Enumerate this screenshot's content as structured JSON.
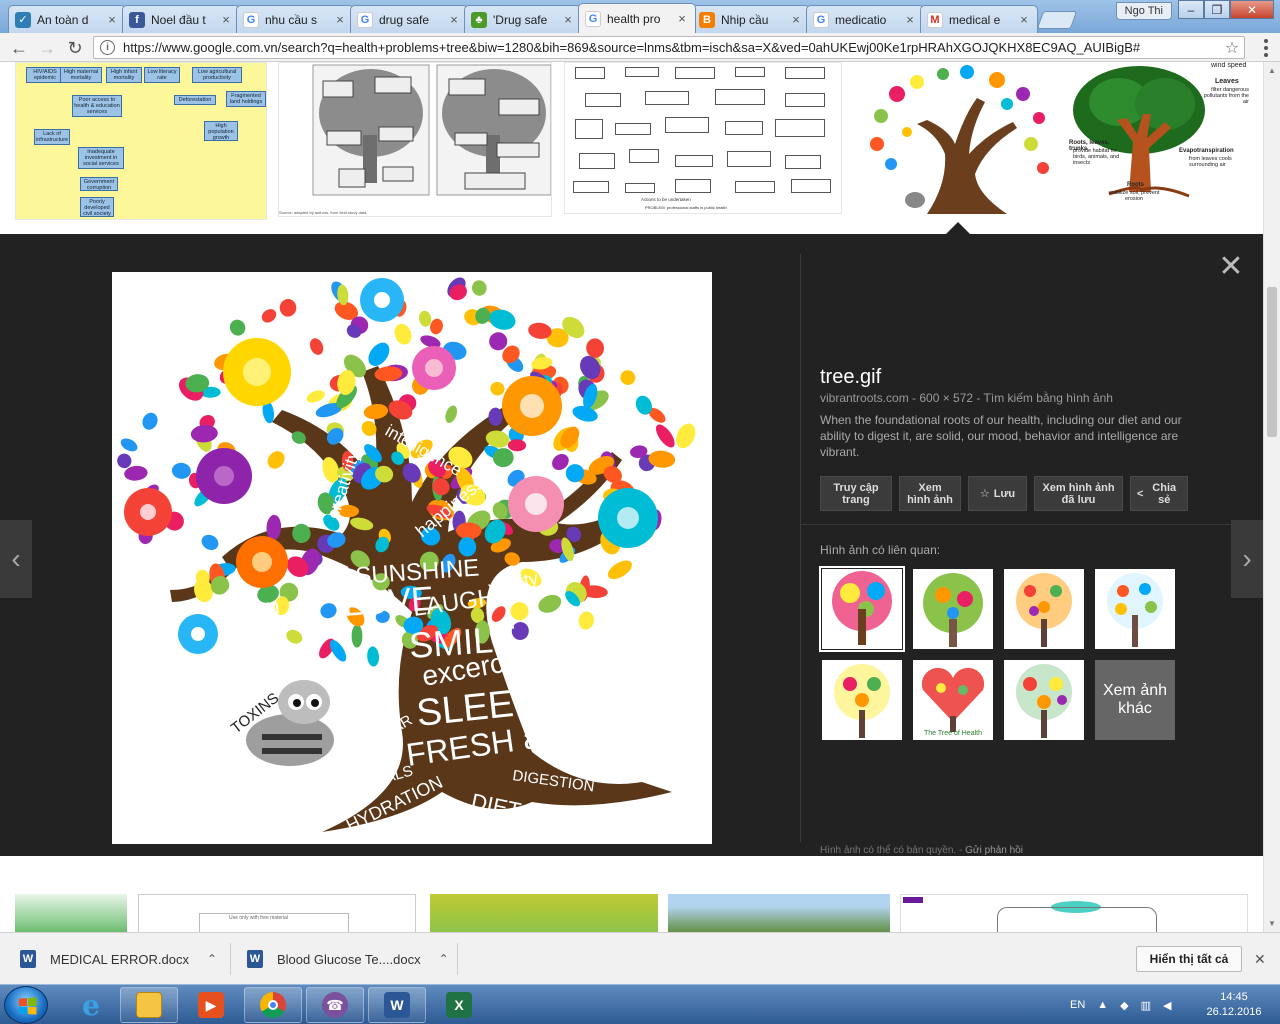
{
  "browser": {
    "tabs": [
      {
        "label": "An toàn d",
        "icon": "shield-favicon",
        "color": "#2f7fb5"
      },
      {
        "label": "Noel đầu t",
        "icon": "facebook-favicon",
        "color": "#3b5998"
      },
      {
        "label": "nhu cầu s",
        "icon": "google-favicon",
        "color": "#4285f4"
      },
      {
        "label": "drug safe",
        "icon": "google-favicon",
        "color": "#4285f4"
      },
      {
        "label": "'Drug safe",
        "icon": "tree-favicon",
        "color": "#4c9a2a"
      },
      {
        "label": "health pro",
        "icon": "google-favicon",
        "color": "#4285f4",
        "active": true
      },
      {
        "label": "Nhip cầu",
        "icon": "blogger-favicon",
        "color": "#f57d00"
      },
      {
        "label": "medicatio",
        "icon": "google-favicon",
        "color": "#4285f4"
      },
      {
        "label": "medical e",
        "icon": "gmail-favicon",
        "color": "#d93025"
      }
    ],
    "user": "Ngo Thi",
    "url": "https://www.google.com.vn/search?q=health+problems+tree&biw=1280&bih=869&source=lnms&tbm=isch&sa=X&ved=0ahUKEwj00Ke1rpHRAhXGOJQKHX8EC9AQ_AUIBigB#"
  },
  "top_thumbs": {
    "flow_labels": [
      "HIV/AIDS epidemic",
      "High maternal mortality",
      "High infant mortality",
      "Low literacy rate",
      "Low agricultural productivity",
      "Deforestation",
      "Fragmented land holdings",
      "Poor access to health & education services",
      "Lack of infrastructure",
      "Inadequate investment in social services",
      "High population growth",
      "Government corruption",
      "Poorly developed civil society"
    ],
    "caption_2": "Source: adapted by authors, from field study data.",
    "caption_3": "PROBLEM: professional staffs in public health",
    "caption_3b": "Actions to be undertaken",
    "tree_labels": [
      "Leaves",
      "filter dangerous pollutants from the air",
      "wind speed",
      "Roots, leaves, trunks",
      "provide habitat for birds, animals, and insects",
      "Evapotranspiration",
      "from leaves cools surrounding air",
      "Roots",
      "stabilize soil, prevent erosion"
    ]
  },
  "preview": {
    "title": "tree.gif",
    "meta": "vibrantroots.com  -  600 × 572  -  Tìm kiếm bằng hình ảnh",
    "description": "When the foundational roots of our health, including our diet and our ability to digest it, are solid, our mood, behavior and intelligence are vibrant.",
    "buttons": [
      {
        "label": "Truy cập trang"
      },
      {
        "label": "Xem hình ảnh"
      },
      {
        "label": "Lưu"
      },
      {
        "label": "Xem hình ảnh đã lưu"
      },
      {
        "label": "Chia sẻ"
      }
    ],
    "related_label": "Hình ảnh có liên quan:",
    "more_label": "Xem ảnh khác",
    "copyright": "Hình ảnh có thể có bản quyền.",
    "feedback": "Gửi phản hồi",
    "tree_words": [
      "intelligence",
      "creativity",
      "health",
      "happiness",
      "SUNSHINE",
      "LOVE",
      "LAUGH",
      "vitality",
      "calm",
      "SMILE",
      "excercise",
      "SLEEP",
      "FRESH air",
      "TOXINS",
      "BLOOD SUGAR",
      "MINERALS",
      "HYDRATION",
      "DIET",
      "DIGESTION",
      "FATS"
    ],
    "related_tree_caption": "The Tree of Health"
  },
  "bottom_thumbs": {
    "caption": "Use only with free material"
  },
  "downloads": {
    "items": [
      {
        "name": "MEDICAL ERROR.docx"
      },
      {
        "name": "Blood Glucose Te....docx"
      }
    ],
    "show_all": "Hiển thị tất cả"
  },
  "taskbar": {
    "lang": "EN",
    "time": "14:45",
    "date": "26.12.2016"
  }
}
